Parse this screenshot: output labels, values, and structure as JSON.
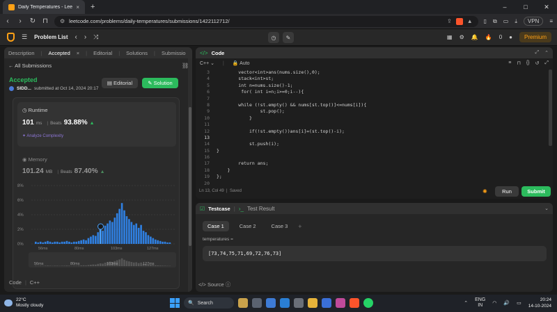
{
  "browser": {
    "tab_title": "Daily Temperatures - LeetCode",
    "tab_close": "×",
    "new_tab": "+",
    "url": "leetcode.com/problems/daily-temperatures/submissions/1422112712/",
    "vpn": "VPN",
    "win_min": "–",
    "win_max": "□",
    "win_close": "✕"
  },
  "lc_nav": {
    "problem_list": "Problem List",
    "coins": "0",
    "premium": "Premium"
  },
  "left": {
    "tabs": [
      "Description",
      "Accepted",
      "Editorial",
      "Solutions",
      "Submissio"
    ],
    "all_submissions": "All Submissions",
    "status": "Accepted",
    "user": "SIDD...",
    "submitted": "submitted at Oct 14, 2024 20:17",
    "editorial_btn": "Editorial",
    "solution_btn": "Solution",
    "runtime_label": "Runtime",
    "runtime_value": "101",
    "runtime_unit": "ms",
    "runtime_beats_label": "Beats",
    "runtime_beats": "93.88%",
    "analyze": "Analyze Complexity",
    "memory_label": "Memory",
    "memory_value": "101.24",
    "memory_unit": "MB",
    "memory_beats_label": "Beats",
    "memory_beats": "87.40%",
    "bottom_code": "Code",
    "bottom_lang": "C++"
  },
  "chart_data": {
    "type": "bar",
    "y_ticks": [
      "8%",
      "6%",
      "4%",
      "2%",
      "0%"
    ],
    "x_ticks": [
      "56ms",
      "80ms",
      "103ms",
      "127ms"
    ],
    "ylim": [
      0,
      8
    ],
    "values": [
      0.3,
      0.2,
      0.3,
      0.2,
      0.3,
      0.4,
      0.3,
      0.2,
      0.3,
      0.3,
      0.2,
      0.3,
      0.3,
      0.4,
      0.3,
      0.2,
      0.3,
      0.3,
      0.4,
      0.5,
      0.6,
      0.5,
      0.8,
      1.0,
      1.2,
      1.1,
      1.6,
      2.0,
      1.8,
      2.5,
      2.8,
      3.2,
      3.0,
      3.6,
      4.2,
      4.8,
      5.6,
      4.6,
      3.8,
      3.4,
      3.0,
      2.6,
      2.8,
      2.2,
      2.6,
      1.8,
      1.6,
      1.2,
      1.0,
      0.8,
      0.6,
      0.5,
      0.4,
      0.3,
      0.3,
      0.2,
      0.2
    ],
    "highlight_index": 27,
    "mini_x_ticks": [
      "56ms",
      "80ms",
      "103ms",
      "127ms"
    ]
  },
  "code": {
    "title": "Code",
    "lang": "C++",
    "auto": "Auto",
    "status": "Ln 13, Col 49",
    "saved": "Saved",
    "run": "Run",
    "submit": "Submit",
    "lines": [
      {
        "n": "3",
        "t": "        vector<int>ans(nums.size(),0);"
      },
      {
        "n": "4",
        "t": "        stack<int>st;"
      },
      {
        "n": "5",
        "t": "        int n=nums.size()-1;"
      },
      {
        "n": "6",
        "t": "         for( int i=n;i>=0;i--){"
      },
      {
        "n": "7",
        "t": ""
      },
      {
        "n": "8",
        "t": "        while (!st.empty() && nums[st.top()]<=nums[i]){"
      },
      {
        "n": "9",
        "t": "                st.pop();"
      },
      {
        "n": "10",
        "t": "            }"
      },
      {
        "n": "11",
        "t": ""
      },
      {
        "n": "12",
        "t": "            if(!st.empty())ans[i]=(st.top()-i);"
      },
      {
        "n": "13",
        "t": ""
      },
      {
        "n": "14",
        "t": "            st.push(i);"
      },
      {
        "n": "15",
        "t": "}"
      },
      {
        "n": "16",
        "t": ""
      },
      {
        "n": "17",
        "t": "        return ans;"
      },
      {
        "n": "18",
        "t": "    }"
      },
      {
        "n": "19",
        "t": "};"
      }
    ],
    "line_numbers": [
      "3",
      "4",
      "5",
      "6",
      "7",
      "8",
      "9",
      "10",
      "11",
      "12",
      "13",
      "14",
      "15",
      "16",
      "17",
      "18",
      "19",
      "20"
    ]
  },
  "testcase": {
    "tab": "Testcase",
    "result_tab": "Test Result",
    "cases": [
      "Case 1",
      "Case 2",
      "Case 3"
    ],
    "plus": "+",
    "var_label": "temperatures =",
    "value": "[73,74,75,71,69,72,76,73]",
    "source": "Source"
  },
  "taskbar": {
    "temp": "22°C",
    "weather": "Mostly cloudy",
    "search": "Search",
    "lang": "ENG",
    "region": "IN",
    "time": "20:24",
    "date": "14-10-2024"
  }
}
